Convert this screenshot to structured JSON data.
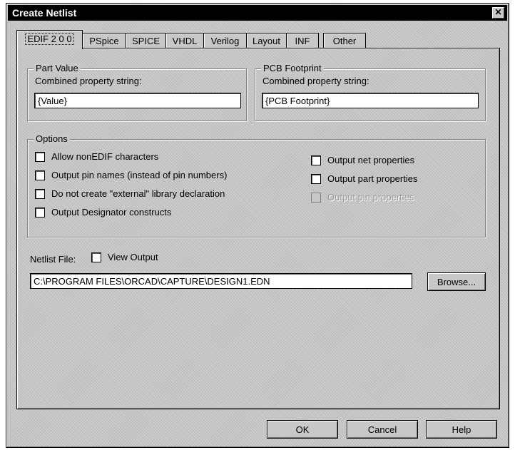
{
  "dialog": {
    "title": "Create Netlist",
    "close_glyph": "✕"
  },
  "tabs": [
    {
      "label": "EDIF 2 0 0",
      "active": true
    },
    {
      "label": "PSpice"
    },
    {
      "label": "SPICE"
    },
    {
      "label": "VHDL"
    },
    {
      "label": "Verilog"
    },
    {
      "label": "Layout"
    },
    {
      "label": "INF"
    },
    {
      "label": "Other"
    }
  ],
  "part_value": {
    "group_label": "Part Value",
    "field_label": "Combined property string:",
    "value": "{Value}"
  },
  "pcb_footprint": {
    "group_label": "PCB Footprint",
    "field_label": "Combined property string:",
    "value": "{PCB Footprint}"
  },
  "options": {
    "group_label": "Options",
    "left": [
      {
        "label": "Allow nonEDIF characters",
        "checked": false
      },
      {
        "label": "Output pin names (instead of pin numbers)",
        "checked": false
      },
      {
        "label": "Do not create \"external\" library declaration",
        "checked": false
      },
      {
        "label": "Output Designator constructs",
        "checked": false
      }
    ],
    "right": [
      {
        "label": "Output net properties",
        "checked": false,
        "enabled": true
      },
      {
        "label": "Output part properties",
        "checked": false,
        "enabled": true
      },
      {
        "label": "Output pin properties",
        "checked": false,
        "enabled": false
      }
    ]
  },
  "netlist": {
    "file_label": "Netlist File:",
    "view_output_label": "View Output",
    "view_output_checked": false,
    "path": "C:\\PROGRAM FILES\\ORCAD\\CAPTURE\\DESIGN1.EDN",
    "browse_label": "Browse..."
  },
  "buttons": {
    "ok": "OK",
    "cancel": "Cancel",
    "help": "Help"
  }
}
